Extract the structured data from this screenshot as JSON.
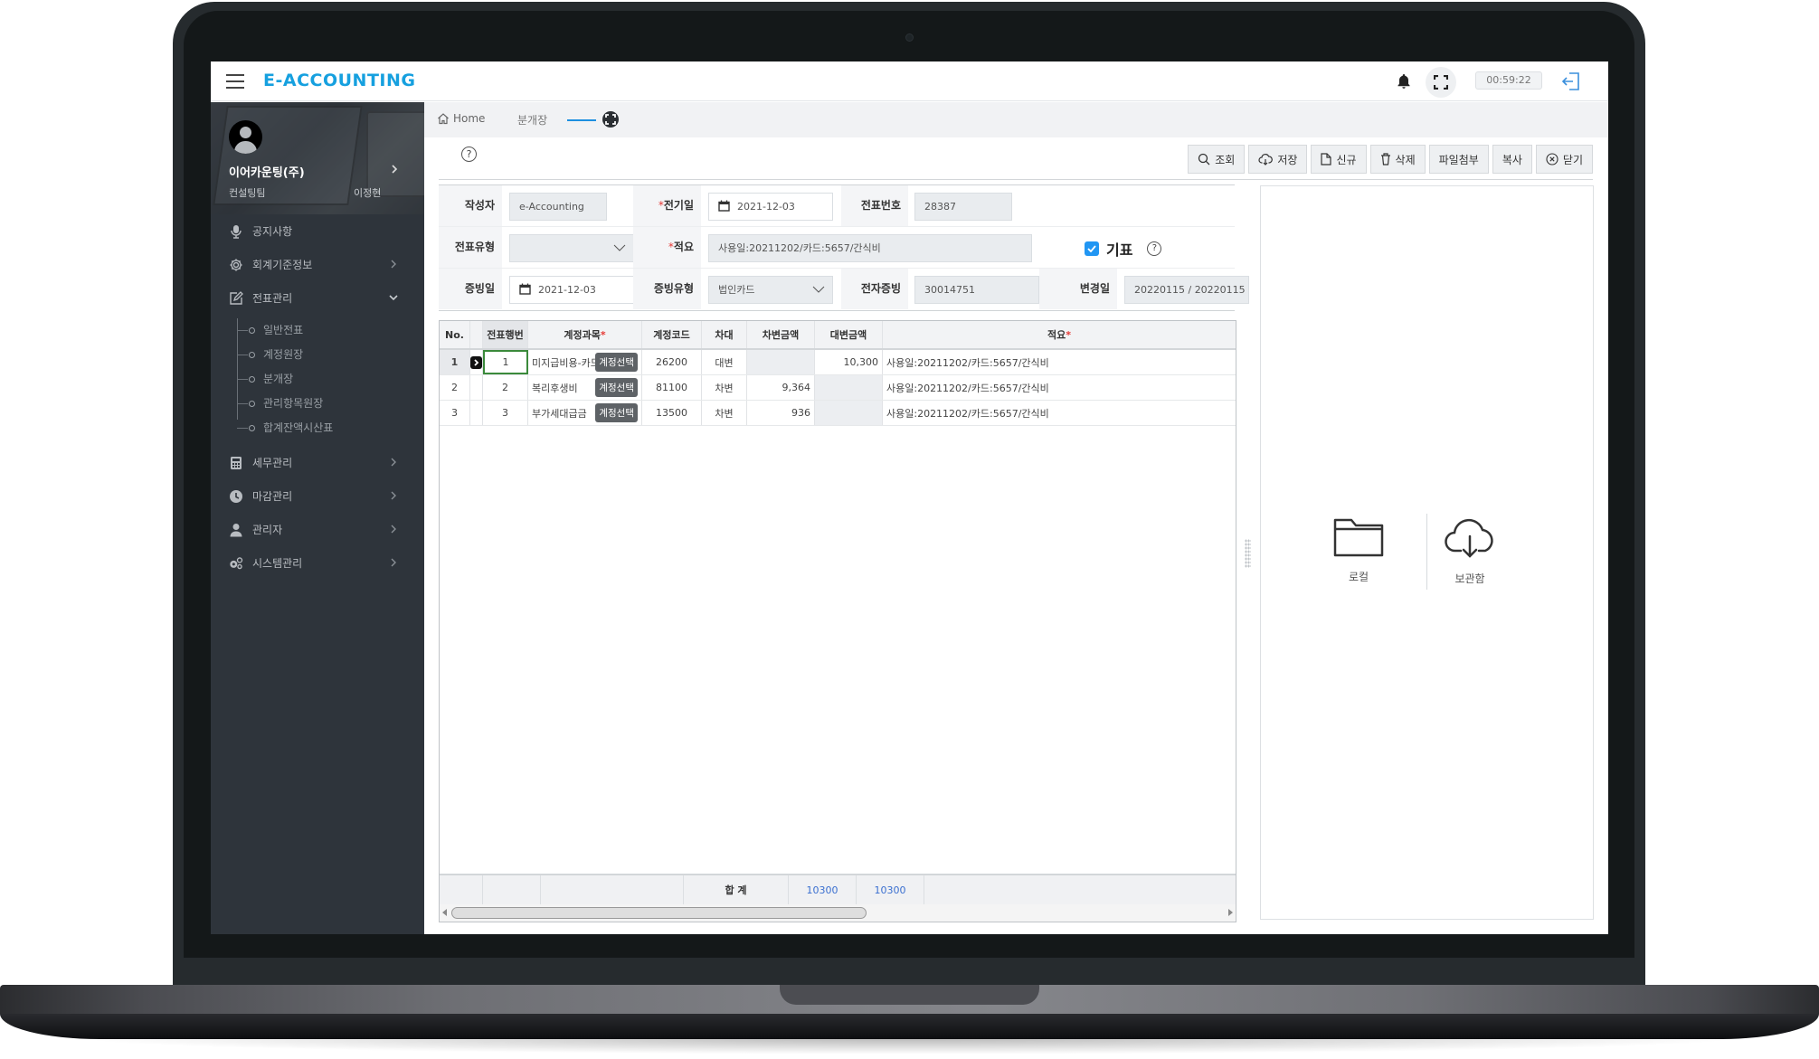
{
  "app": {
    "logo": "E-ACCOUNTING",
    "timer": "00:59:22",
    "icons": {
      "menu": "hamburger-icon",
      "bell": "bell-icon",
      "fullscreen": "fullscreen-icon",
      "logout": "logout-icon"
    }
  },
  "profile": {
    "company": "이어카운팅(주)",
    "department": "컨설팅팀",
    "user": "이정현"
  },
  "sidebar": {
    "items": [
      {
        "label": "공지사항",
        "icon": "microphone-icon",
        "chevron": ""
      },
      {
        "label": "회계기준정보",
        "icon": "gear-icon",
        "chevron": "right"
      },
      {
        "label": "전표관리",
        "icon": "edit-icon",
        "chevron": "down",
        "expanded": true,
        "children": [
          "일반전표",
          "계정원장",
          "분개장",
          "관리항목원장",
          "합계잔액시산표"
        ]
      },
      {
        "label": "세무관리",
        "icon": "calculator-icon",
        "chevron": "right"
      },
      {
        "label": "마감관리",
        "icon": "clock-icon",
        "chevron": "right"
      },
      {
        "label": "관리자",
        "icon": "user-icon",
        "chevron": "right"
      },
      {
        "label": "시스템관리",
        "icon": "gears-icon",
        "chevron": "right"
      }
    ]
  },
  "breadcrumb": {
    "home": "Home",
    "current": "분개장"
  },
  "toolbar": {
    "buttons": [
      {
        "label": "조회",
        "icon": "search-icon"
      },
      {
        "label": "저장",
        "icon": "cloud-save-icon"
      },
      {
        "label": "신규",
        "icon": "new-document-icon"
      },
      {
        "label": "삭제",
        "icon": "trash-icon"
      },
      {
        "label": "파일첨부",
        "icon": ""
      },
      {
        "label": "복사",
        "icon": ""
      },
      {
        "label": "닫기",
        "icon": "close-circle-icon"
      }
    ]
  },
  "form": {
    "writer": {
      "label": "작성자",
      "value": "e-Accounting"
    },
    "post_date": {
      "label": "전기일",
      "required": "*",
      "value": "2021-12-03"
    },
    "voucher_no": {
      "label": "전표번호",
      "value": "28387"
    },
    "voucher_type": {
      "label": "전표유형",
      "value": ""
    },
    "summary": {
      "label": "적요",
      "required": "*",
      "value": "사용일:20211202/카드:5657/간식비"
    },
    "gipyo": {
      "label": "기표",
      "checked": true,
      "help": "?"
    },
    "evidence_date": {
      "label": "증빙일",
      "value": "2021-12-03"
    },
    "evidence_type": {
      "label": "증빙유형",
      "value": "법인카드"
    },
    "e_evidence": {
      "label": "전자증빙",
      "value": "30014751"
    },
    "changed_date": {
      "label": "변경일",
      "value": "20220115 / 20220115"
    }
  },
  "grid": {
    "columns": [
      "No.",
      "",
      "전표행번",
      "계정과목",
      "계정코드",
      "차대",
      "차변금액",
      "대변금액",
      "적요"
    ],
    "required_mark": "*",
    "account_button": "계정선택",
    "rows": [
      {
        "no": "1",
        "line": "1",
        "account": "미지급비용-카드",
        "code": "26200",
        "dc": "대변",
        "debit": "",
        "credit": "10,300",
        "summary": "사용일:20211202/카드:5657/간식비"
      },
      {
        "no": "2",
        "line": "2",
        "account": "복리후생비",
        "code": "81100",
        "dc": "차변",
        "debit": "9,364",
        "credit": "",
        "summary": "사용일:20211202/카드:5657/간식비"
      },
      {
        "no": "3",
        "line": "3",
        "account": "부가세대급금",
        "code": "13500",
        "dc": "차변",
        "debit": "936",
        "credit": "",
        "summary": "사용일:20211202/카드:5657/간식비"
      }
    ],
    "footer": {
      "label": "합 계",
      "debit_total": "10300",
      "credit_total": "10300"
    }
  },
  "attachments": {
    "options": [
      {
        "label": "로컬",
        "icon": "folder-icon"
      },
      {
        "label": "보관함",
        "icon": "cloud-download-icon"
      }
    ]
  },
  "colors": {
    "brand": "#16a0df",
    "sidebar": "#2e343b",
    "required": "#e53935",
    "total": "#3a6fd0",
    "checkbox": "#2196f3"
  }
}
